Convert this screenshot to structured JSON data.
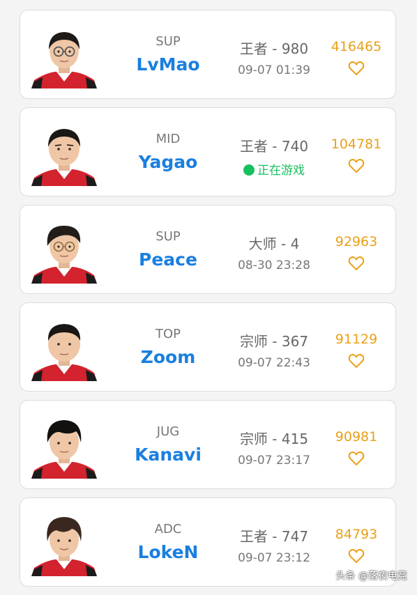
{
  "players": [
    {
      "role": "SUP",
      "name": "LvMao",
      "rank": "王者 - 980",
      "last_active": "09-07 01:39",
      "score": "416465",
      "hair": "#1e1a18",
      "glasses": true
    },
    {
      "role": "MID",
      "name": "Yagao",
      "rank": "王者 - 740",
      "last_active": "",
      "online_label": "正在游戏",
      "score": "104781",
      "hair": "#1a1715",
      "glasses": false
    },
    {
      "role": "SUP",
      "name": "Peace",
      "rank": "大师 - 4",
      "last_active": "08-30 23:28",
      "score": "92963",
      "hair": "#231d1a",
      "glasses": true
    },
    {
      "role": "TOP",
      "name": "Zoom",
      "rank": "宗师 - 367",
      "last_active": "09-07 22:43",
      "score": "91129",
      "hair": "#191614",
      "glasses": false
    },
    {
      "role": "JUG",
      "name": "Kanavi",
      "rank": "宗师 - 415",
      "last_active": "09-07 23:17",
      "score": "90981",
      "hair": "#121110",
      "glasses": false
    },
    {
      "role": "ADC",
      "name": "LokeN",
      "rank": "王者 - 747",
      "last_active": "09-07 23:12",
      "score": "84793",
      "hair": "#3a2820",
      "glasses": false
    }
  ],
  "icons": {
    "favorite": "heart-outline-icon",
    "status": "green-dot-icon"
  },
  "colors": {
    "name": "#1a7fe0",
    "score": "#eaa018",
    "online": "#17c05e",
    "jersey": "#d3232e"
  },
  "watermark": "头条 @落夜电竞"
}
